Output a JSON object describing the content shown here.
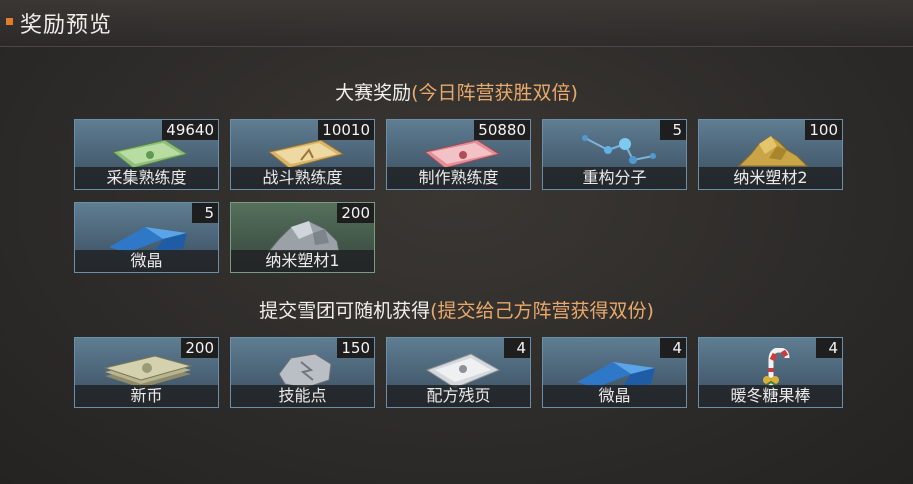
{
  "header": {
    "title": "奖励预览"
  },
  "section1": {
    "title_main": "大赛奖励",
    "title_highlight": "(今日阵营获胜双倍)"
  },
  "section2": {
    "title_main": "提交雪团可随机获得",
    "title_highlight": "(提交给己方阵营获得双份)"
  },
  "contest_rewards": [
    {
      "name": "采集熟练度",
      "count": "49640",
      "icon": "green-certificate-icon"
    },
    {
      "name": "战斗熟练度",
      "count": "10010",
      "icon": "yellow-certificate-icon"
    },
    {
      "name": "制作熟练度",
      "count": "50880",
      "icon": "red-certificate-icon"
    },
    {
      "name": "重构分子",
      "count": "5",
      "icon": "molecule-icon"
    },
    {
      "name": "纳米塑材2",
      "count": "100",
      "icon": "gold-nano-material-icon"
    },
    {
      "name": "微晶",
      "count": "5",
      "icon": "microcrystal-icon"
    },
    {
      "name": "纳米塑材1",
      "count": "200",
      "icon": "silver-nano-material-icon"
    }
  ],
  "snowball_rewards": [
    {
      "name": "新币",
      "count": "200",
      "icon": "banknote-stack-icon"
    },
    {
      "name": "技能点",
      "count": "150",
      "icon": "skill-point-stone-icon"
    },
    {
      "name": "配方残页",
      "count": "4",
      "icon": "recipe-page-icon"
    },
    {
      "name": "微晶",
      "count": "4",
      "icon": "microcrystal-icon"
    },
    {
      "name": "暖冬糖果棒",
      "count": "4",
      "icon": "candy-cane-icon"
    }
  ]
}
